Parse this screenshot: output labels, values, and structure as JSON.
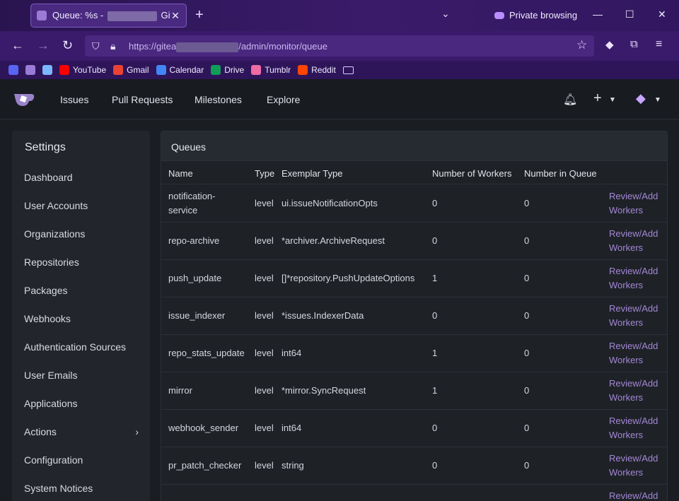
{
  "browser": {
    "tab_title_prefix": "Queue: %s -",
    "tab_title_suffix": "Gitea",
    "private_label": "Private browsing",
    "url_prefix": "https://gitea",
    "url_suffix": "/admin/monitor/queue",
    "bookmarks": [
      {
        "label": "",
        "icon": "discord-icon",
        "color": "#5865f2"
      },
      {
        "label": "",
        "icon": "gitea-bookmark-icon",
        "color": "#9a7bd6"
      },
      {
        "label": "",
        "icon": "triangle-bookmark-icon",
        "color": "#7bb6ff"
      },
      {
        "label": "YouTube",
        "icon": "youtube-icon",
        "color": "#ff0000"
      },
      {
        "label": "Gmail",
        "icon": "gmail-icon",
        "color": "#ea4335"
      },
      {
        "label": "Calendar",
        "icon": "calendar-icon",
        "color": "#4285f4"
      },
      {
        "label": "Drive",
        "icon": "drive-icon",
        "color": "#0f9d58"
      },
      {
        "label": "Tumblr",
        "icon": "tumblr-icon",
        "color": "#ef6ba5"
      },
      {
        "label": "Reddit",
        "icon": "reddit-icon",
        "color": "#ff4500"
      },
      {
        "label": "",
        "icon": "folder-icon",
        "color": "#d8cfff"
      }
    ]
  },
  "header": {
    "nav": [
      "Issues",
      "Pull Requests",
      "Milestones",
      "Explore"
    ]
  },
  "sidebar": {
    "title": "Settings",
    "items": [
      "Dashboard",
      "User Accounts",
      "Organizations",
      "Repositories",
      "Packages",
      "Webhooks",
      "Authentication Sources",
      "User Emails",
      "Applications",
      "Actions",
      "Configuration",
      "System Notices"
    ]
  },
  "queues": {
    "title": "Queues",
    "columns": [
      "Name",
      "Type",
      "Exemplar Type",
      "Number of Workers",
      "Number in Queue"
    ],
    "action_line1": "Review/Add",
    "action_line2": "Workers",
    "rows": [
      {
        "name1": "notification-",
        "name2": "service",
        "type": "level",
        "exemplar": "ui.issueNotificationOpts",
        "workers": "0",
        "in_queue": "0"
      },
      {
        "name1": "repo-archive",
        "name2": "",
        "type": "level",
        "exemplar": "*archiver.ArchiveRequest",
        "workers": "0",
        "in_queue": "0"
      },
      {
        "name1": "push_update",
        "name2": "",
        "type": "level",
        "exemplar": "[]*repository.PushUpdateOptions",
        "workers": "1",
        "in_queue": "0"
      },
      {
        "name1": "issue_indexer",
        "name2": "",
        "type": "level",
        "exemplar": "*issues.IndexerData",
        "workers": "0",
        "in_queue": "0"
      },
      {
        "name1": "repo_stats_update",
        "name2": "",
        "type": "level",
        "exemplar": "int64",
        "workers": "1",
        "in_queue": "0"
      },
      {
        "name1": "mirror",
        "name2": "",
        "type": "level",
        "exemplar": "*mirror.SyncRequest",
        "workers": "1",
        "in_queue": "0"
      },
      {
        "name1": "webhook_sender",
        "name2": "",
        "type": "level",
        "exemplar": "int64",
        "workers": "0",
        "in_queue": "0"
      },
      {
        "name1": "pr_patch_checker",
        "name2": "",
        "type": "level",
        "exemplar": "string",
        "workers": "0",
        "in_queue": "0"
      }
    ]
  }
}
